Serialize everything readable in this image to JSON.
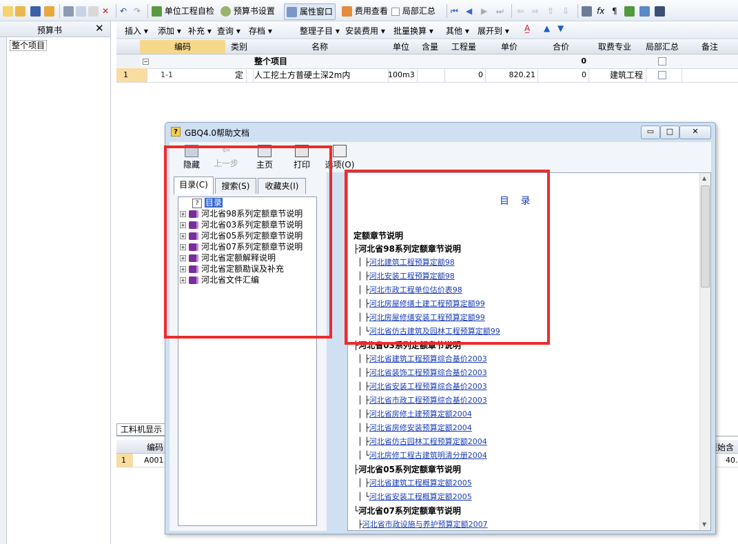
{
  "toolbar": {
    "self_check": "单位工程自检",
    "budget_settings": "预算书设置",
    "property_window": "属性窗口",
    "fee_view": "费用查看",
    "partial_summary": "局部汇总"
  },
  "left_panel": {
    "title": "预算书",
    "close": "✕",
    "tree_item": "整个项目"
  },
  "toolbar2": {
    "items": [
      "插入 ▾",
      "添加 ▾",
      "补充 ▾",
      "查询 ▾",
      "存档 ▾",
      "整理子目 ▾",
      "安装费用 ▾",
      "批量换算 ▾",
      "其他 ▾",
      "展开到 ▾"
    ]
  },
  "grid": {
    "headers": [
      "编码",
      "类别",
      "名称",
      "单位",
      "含量",
      "工程量",
      "单价",
      "合价",
      "取费专业",
      "局部汇总",
      "备注"
    ],
    "summary_row": {
      "name": "整个项目",
      "total": "0"
    },
    "row1": {
      "num": "1",
      "code": "1-1",
      "type": "定",
      "name": "人工挖土方普硬土深2m内",
      "unit": "100m3",
      "qty": "0",
      "price": "820.21",
      "total": "0",
      "fee": "建筑工程"
    }
  },
  "bottom_panel": {
    "tab": "工料机显示",
    "header_code": "编码",
    "row_num": "1",
    "row_code": "A001",
    "right_header": "原始含",
    "right_value": "40."
  },
  "help_window": {
    "title": "GBQ4.0帮助文档",
    "tools": {
      "hide": "隐藏",
      "back": "上一步",
      "home": "主页",
      "print": "打印",
      "options": "选项(O)"
    },
    "tabs": [
      "目录(C)",
      "搜索(S)",
      "收藏夹(I)"
    ],
    "tree": [
      "目录",
      "河北省98系列定额章节说明",
      "河北省03系列定额章节说明",
      "河北省05系列定额章节说明",
      "河北省07系列定额章节说明",
      "河北省定额解释说明",
      "河北省定额勘误及补充",
      "河北省文件汇编"
    ],
    "content": {
      "heading": "目 录",
      "section": "定额章节说明",
      "lines": [
        {
          "prefix": "├",
          "text": "河北省98系列定额章节说明",
          "bold": true
        },
        {
          "prefix": "│ ├",
          "text": "河北建筑工程预算定额98",
          "link": true
        },
        {
          "prefix": "│ ├",
          "text": "河北安装工程预算定额98",
          "link": true
        },
        {
          "prefix": "│ ├",
          "text": "河北市政工程单位估价表98",
          "link": true
        },
        {
          "prefix": "│ ├",
          "text": "河北房屋修缮土建工程预算定额99",
          "link": true
        },
        {
          "prefix": "│ ├",
          "text": "河北房屋修缮安装工程预算定额99",
          "link": true
        },
        {
          "prefix": "│ └",
          "text": "河北省仿古建筑及园林工程预算定额99",
          "link": true
        },
        {
          "prefix": "├",
          "text": "河北省03系列定额章节说明",
          "bold": true
        },
        {
          "prefix": "│ ├",
          "text": "河北省建筑工程预算综合基价2003",
          "link": true
        },
        {
          "prefix": "│ ├",
          "text": "河北省装饰工程预算综合基价2003",
          "link": true
        },
        {
          "prefix": "│ ├",
          "text": "河北省安装工程预算综合基价2003",
          "link": true
        },
        {
          "prefix": "│ ├",
          "text": "河北省市政工程预算综合基价2003",
          "link": true
        },
        {
          "prefix": "│ ├",
          "text": "河北省房修土建预算定额2004",
          "link": true
        },
        {
          "prefix": "│ ├",
          "text": "河北省房修安装预算定额2004",
          "link": true
        },
        {
          "prefix": "│ ├",
          "text": "河北省仿古园林工程预算定额2004",
          "link": true
        },
        {
          "prefix": "│ └",
          "text": "河北房修工程古建筑明清分册2004",
          "link": true
        },
        {
          "prefix": "├",
          "text": "河北省05系列定额章节说明",
          "bold": true
        },
        {
          "prefix": "│ ├",
          "text": "河北省建筑工程概算定额2005",
          "link": true
        },
        {
          "prefix": "│ └",
          "text": "河北省安装工程概算定额2005",
          "link": true
        },
        {
          "prefix": "└",
          "text": "河北省07系列定额章节说明",
          "bold": true
        },
        {
          "prefix": "  ├",
          "text": "河北省市政设施与养护预算定额2007",
          "link": true
        }
      ]
    }
  },
  "colors": {
    "highlight": "#ee2b2b",
    "link": "#1a3cb5",
    "accent": "#f5d88a"
  }
}
